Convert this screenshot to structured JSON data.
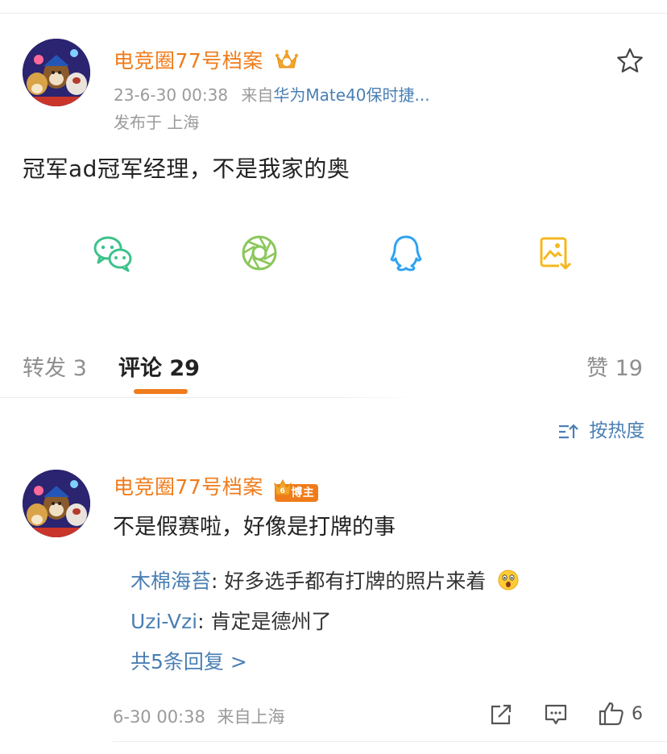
{
  "post": {
    "author": "电竞圈77号档案",
    "time": "23-6-30 00:38",
    "source_prefix": "来自",
    "source": "华为Mate40保时捷...",
    "location": "发布于 上海",
    "text": "冠军ad冠军经理，不是我家的奥",
    "star_icon": "star-outline-icon"
  },
  "share": {
    "icons": [
      "wechat-icon",
      "moments-icon",
      "qq-icon",
      "save-image-icon"
    ]
  },
  "tabs": {
    "repost": "转发 3",
    "comments": "评论 29",
    "likes": "赞 19"
  },
  "sort": {
    "label": "按热度"
  },
  "comment": {
    "author": "电竞圈77号档案",
    "badge_level": "6",
    "badge": "博主",
    "text": "不是假赛啦，好像是打牌的事",
    "replies": [
      {
        "name": "木棉海苔",
        "text": ": 好多选手都有打牌的照片来着",
        "emoji": "surprised-emoji-icon"
      },
      {
        "name": "Uzi-Vzi",
        "text": ": 肯定是德州了"
      }
    ],
    "more": "共5条回复 >",
    "time": "6-30 00:38",
    "source": "来自上海",
    "like_count": "6"
  },
  "colors": {
    "accent": "#f07b1a",
    "link": "#4a7fb3",
    "muted": "#9a9a9a"
  }
}
